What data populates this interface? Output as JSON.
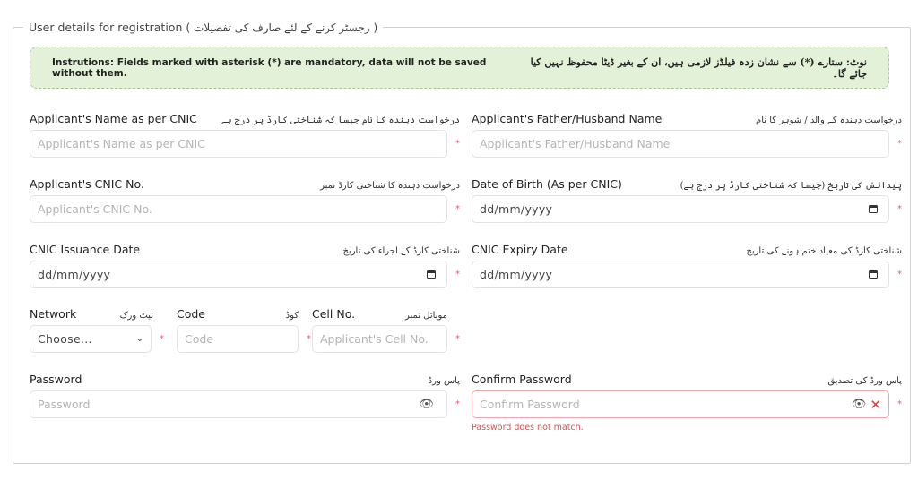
{
  "form": {
    "legend_en": "User details for registration (",
    "legend_ur": " رجسٹر کرنے کے لئے صارف کی تفصیلات ",
    "legend_close": ")",
    "notice_en": "Instrutions: Fields marked with asterisk (*) are mandatory, data will not be saved without them.",
    "notice_ur": "نوٹ: ستارے (*) سے نشان زدہ فیلڈز لازمی ہیں، ان کے بغیر ڈیٹا محفوظ نہیں کیا جائے گا۔",
    "required_mark": "*"
  },
  "fields": {
    "name": {
      "label": "Applicant's Name as per CNIC",
      "label_ur": "درخواست دہندہ کا نام جیسا کہ شناختی کارڈ پر درج ہے",
      "placeholder": "Applicant's Name as per CNIC"
    },
    "father": {
      "label": "Applicant's Father/Husband Name",
      "label_ur": "درخواست دہندہ کے والد / شوہر کا نام",
      "placeholder": "Applicant's Father/Husband Name"
    },
    "cnic": {
      "label": "Applicant's CNIC No.",
      "label_ur": "درخواست دہندہ کا شناختی کارڈ نمبر",
      "placeholder": "Applicant's CNIC No."
    },
    "dob": {
      "label": "Date of Birth (As per CNIC)",
      "label_ur": "پیدائش کی تاریخ (جیسا کہ شناختی کارڈ پر درج ہے)",
      "value": "dd/mm/yyyy"
    },
    "issuance": {
      "label": "CNIC Issuance Date",
      "label_ur": "شناختی کارڈ کے اجراء کی تاریخ",
      "value": "dd/mm/yyyy"
    },
    "expiry": {
      "label": "CNIC Expiry Date",
      "label_ur": "شناختی کارڈ کی معیاد ختم ہونے کی تاریخ",
      "value": "dd/mm/yyyy"
    },
    "network": {
      "label": "Network",
      "label_ur": "نیٹ ورک",
      "selected": "Choose..."
    },
    "code": {
      "label": "Code",
      "label_ur": "کوڈ",
      "placeholder": "Code"
    },
    "cell": {
      "label": "Cell No.",
      "label_ur": "موبائل نمبر",
      "placeholder": "Applicant's Cell No."
    },
    "password": {
      "label": "Password",
      "label_ur": "پاس ورڈ",
      "placeholder": "Password"
    },
    "confirm": {
      "label": "Confirm Password",
      "label_ur": "پاس ورڈ کی تصدیق",
      "placeholder": "Confirm Password",
      "error": "Password does not match."
    }
  },
  "icons": {
    "calendar": "calendar-icon",
    "eye": "👁",
    "x": "✕",
    "chevron": "⌄"
  },
  "colors": {
    "notice_bg": "#e2f1d8",
    "error": "#d9534f",
    "required": "#e0607a"
  }
}
